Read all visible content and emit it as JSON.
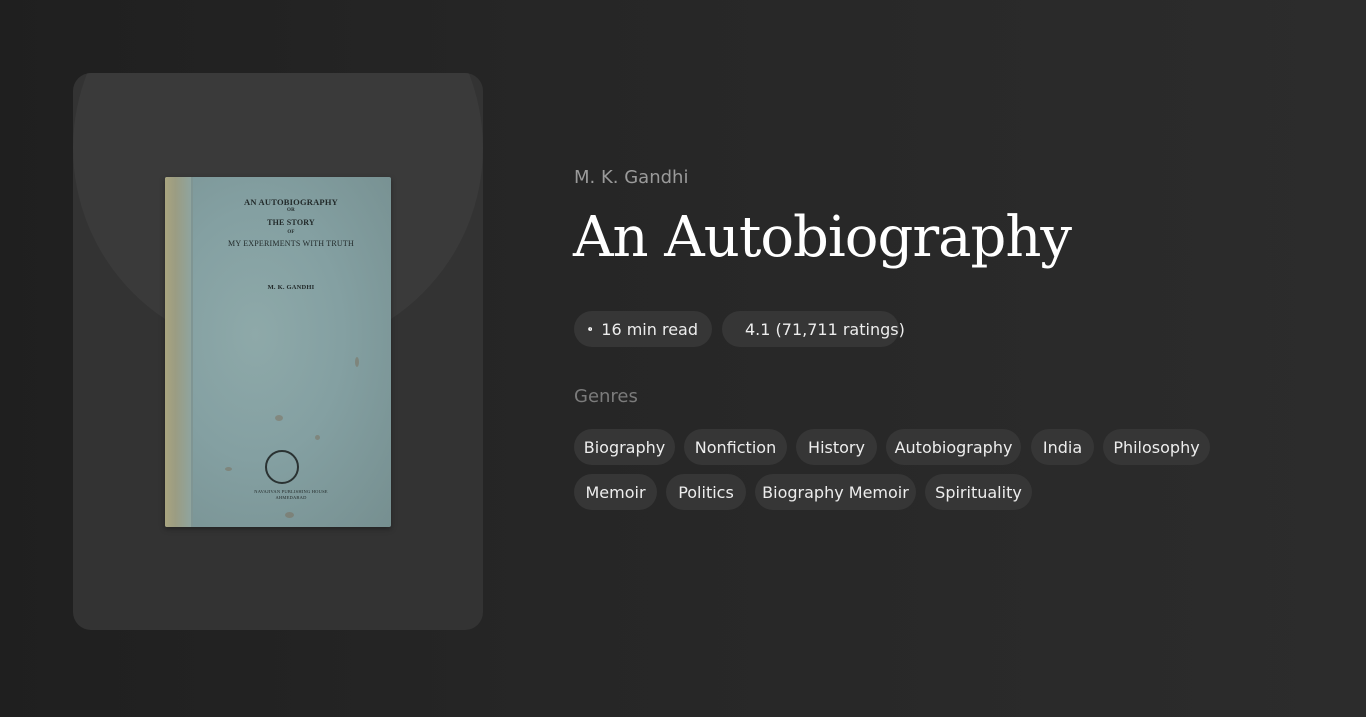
{
  "book": {
    "author": "M. K. Gandhi",
    "title": "An Autobiography",
    "cover": {
      "line1": "AN AUTOBIOGRAPHY",
      "of1": "OR",
      "line2": "THE STORY",
      "of2": "OF",
      "line3": "MY EXPERIMENTS WITH TRUTH",
      "author": "M. K. GANDHI",
      "publisher1": "NAVAJIVAN PUBLISHING HOUSE",
      "publisher2": "AHMEDABAD"
    }
  },
  "meta": {
    "read_time": "16 min read",
    "rating": "4.1 (71,711 ratings)",
    "read_icon": "clock-icon",
    "rating_icon": "star-icon",
    "star_color": "#f5b623"
  },
  "genres": {
    "label": "Genres",
    "items": [
      "Biography",
      "Nonfiction",
      "History",
      "Autobiography",
      "India",
      "Philosophy",
      "Memoir",
      "Politics",
      "Biography Memoir",
      "Spirituality"
    ]
  }
}
